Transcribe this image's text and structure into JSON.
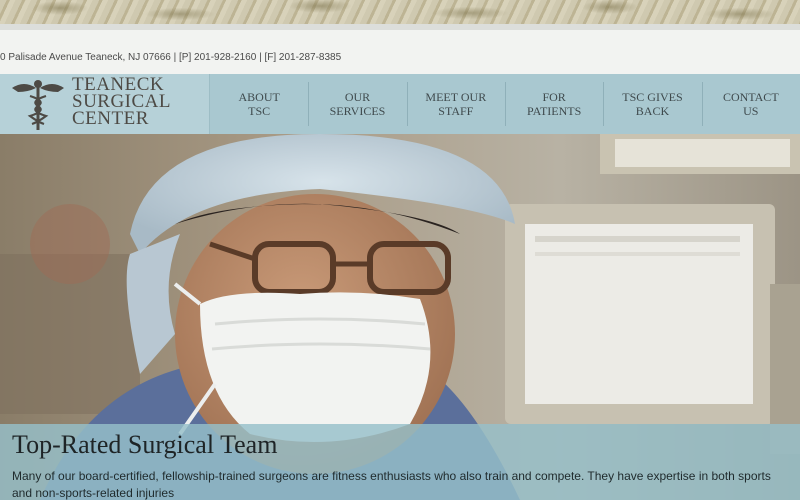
{
  "contact": {
    "address_line": "0 Palisade Avenue Teaneck, NJ 07666 | [P] 201-928-2160 | [F] 201-287-8385"
  },
  "logo": {
    "line1": "TEANECK",
    "line2": "SURGICAL",
    "line3": "CENTER",
    "emblem_icon": "caduceus-icon"
  },
  "nav": {
    "items": [
      {
        "line1": "ABOUT",
        "line2": "TSC"
      },
      {
        "line1": "OUR",
        "line2": "SERVICES"
      },
      {
        "line1": "MEET OUR",
        "line2": "STAFF"
      },
      {
        "line1": "FOR",
        "line2": "PATIENTS"
      },
      {
        "line1": "TSC GIVES",
        "line2": "BACK"
      },
      {
        "line1": "CONTACT",
        "line2": "US"
      }
    ]
  },
  "hero": {
    "caption_title": "Top-Rated Surgical Team",
    "caption_text": "Many of our board-certified, fellowship-trained surgeons are fitness enthusiasts who also train and compete. They have expertise in both sports and non-sports-related injuries"
  },
  "colors": {
    "header_bg": "#a9c8d0",
    "caption_bg": "#96c0c9",
    "nav_text": "#3f4a4d"
  }
}
